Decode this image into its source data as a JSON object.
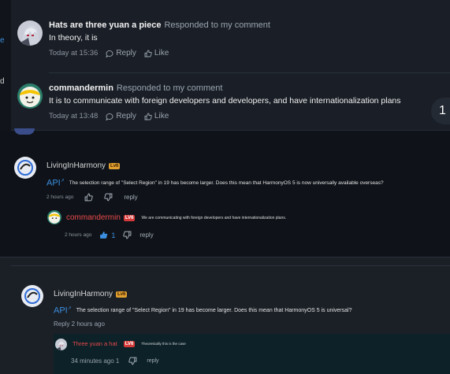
{
  "edge_letters": [
    "e",
    "d"
  ],
  "notifications": [
    {
      "username": "Hats are three yuan a piece",
      "action": "Responded to my comment",
      "text": "In theory, it is",
      "time": "Today at 15:36",
      "reply_label": "Reply",
      "like_label": "Like"
    },
    {
      "username": "commandermin",
      "action": "Responded to my comment",
      "text": "It is to communicate with foreign developers and developers, and have internationalization plans",
      "time": "Today at 13:48",
      "reply_label": "Reply",
      "like_label": "Like"
    }
  ],
  "side_badge": "1",
  "comment1": {
    "username": "LivingInHarmony",
    "level": "Lv6",
    "api_label": "API",
    "text": "The selection range of \"Select Region\" in 19 has become larger. Does this mean that HarmonyOS 5 is now universally available overseas?",
    "time": "2 hours ago",
    "reply_label": "reply",
    "reply": {
      "username": "commandermin",
      "level": "LV6",
      "text": "We are communicating with foreign developers and have internationalization plans.",
      "time": "2 hours ago",
      "likes": "1",
      "reply_label": "reply"
    }
  },
  "comment2": {
    "username": "LivingInHarmony",
    "level": "Lv6",
    "api_label": "API",
    "text": "The selection range of \"Select Region\" in 19 has become larger. Does this mean that HarmonyOS 5 is universal?",
    "meta": "Reply 2 hours ago",
    "reply": {
      "username": "Three yuan a hat",
      "level": "LV6",
      "text": "Theoretically this is the case",
      "time": "34 minutes ago 1",
      "reply_label": "reply"
    }
  },
  "colors": {
    "accent_blue": "#3b8fe0",
    "red_name": "#e84a4a",
    "level_gold": "#e0a030"
  }
}
